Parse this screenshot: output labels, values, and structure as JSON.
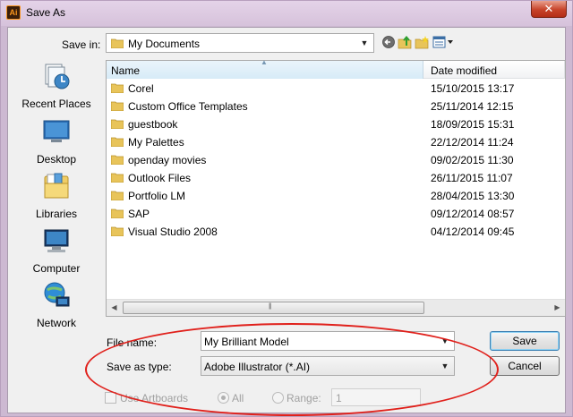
{
  "window": {
    "title": "Save As",
    "close_glyph": "✕"
  },
  "save_in": {
    "label": "Save in:",
    "value": "My Documents"
  },
  "toolbar": {
    "icons": [
      "back-icon",
      "up-folder-icon",
      "new-folder-icon",
      "view-menu-icon"
    ]
  },
  "places": [
    {
      "label": "Recent Places",
      "icon": "recent-places-icon"
    },
    {
      "label": "Desktop",
      "icon": "desktop-icon"
    },
    {
      "label": "Libraries",
      "icon": "libraries-icon"
    },
    {
      "label": "Computer",
      "icon": "computer-icon"
    },
    {
      "label": "Network",
      "icon": "network-icon"
    }
  ],
  "file_list": {
    "columns": {
      "name": "Name",
      "date": "Date modified"
    },
    "rows": [
      {
        "name": "Corel",
        "date": "15/10/2015 13:17"
      },
      {
        "name": "Custom Office Templates",
        "date": "25/11/2014 12:15"
      },
      {
        "name": "guestbook",
        "date": "18/09/2015 15:31"
      },
      {
        "name": "My Palettes",
        "date": "22/12/2014 11:24"
      },
      {
        "name": "openday movies",
        "date": "09/02/2015 11:30"
      },
      {
        "name": "Outlook Files",
        "date": "26/11/2015 11:07"
      },
      {
        "name": "Portfolio LM",
        "date": "28/04/2015 13:30"
      },
      {
        "name": "SAP",
        "date": "09/12/2014 08:57"
      },
      {
        "name": "Visual Studio 2008",
        "date": "04/12/2014 09:45"
      }
    ]
  },
  "file_name": {
    "label": "File name:",
    "value": "My Brilliant Model"
  },
  "save_as_type": {
    "label": "Save as type:",
    "value": "Adobe Illustrator (*.AI)"
  },
  "buttons": {
    "save": "Save",
    "cancel": "Cancel"
  },
  "artboards": {
    "use_label": "Use Artboards",
    "all_label": "All",
    "range_label": "Range:",
    "range_value": "1"
  },
  "colors": {
    "annotation": "#e0201b",
    "folder": "#e8c45a",
    "window_frame": "#cdb9d2"
  }
}
